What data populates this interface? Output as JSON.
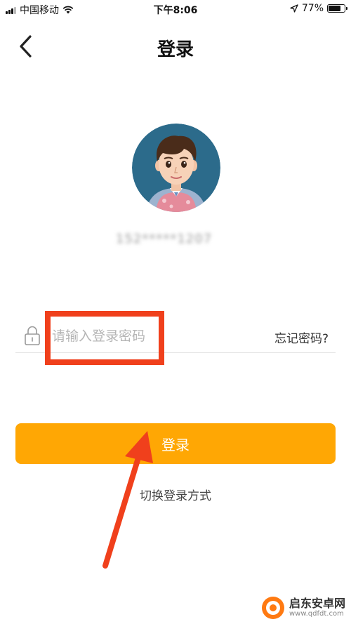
{
  "status_bar": {
    "carrier": "中国移动",
    "time": "下午8:06",
    "battery_text": "77%",
    "battery_level": 0.77
  },
  "nav": {
    "title": "登录"
  },
  "account": {
    "masked": "152*****1207"
  },
  "password": {
    "placeholder": "请输入登录密码",
    "value": "",
    "forgot_label": "忘记密码?"
  },
  "login_button": {
    "label": "登录",
    "color": "#ffa704"
  },
  "switch_method": {
    "label": "切换登录方式"
  },
  "annotation": {
    "color": "#f0401c"
  },
  "watermark": {
    "name": "启东安卓网",
    "url": "www.qdfdt.com"
  }
}
